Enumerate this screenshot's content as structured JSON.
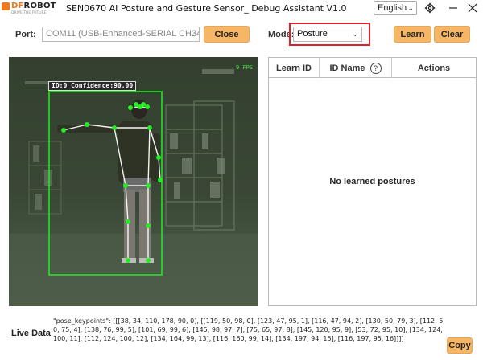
{
  "titlebar": {
    "logo_text_left": "DF",
    "logo_text_right": "ROBOT",
    "logo_tagline": "DRIVE THE FUTURE",
    "app_title": "SEN0670 AI Posture and Gesture Sensor_ Debug Assistant V1.0",
    "language": "English",
    "icons": [
      "settings-icon",
      "minimize-icon",
      "close-icon"
    ]
  },
  "controls": {
    "port_label": "Port:",
    "port_value": "COM11 (USB-Enhanced-SERIAL CH343)",
    "close_label": "Close",
    "mode_label": "Mode:",
    "mode_value": "Posture",
    "learn_label": "Learn",
    "clear_label": "Clear"
  },
  "camera": {
    "fps": "9 FPS",
    "detection_label": "ID:0 Confidence:90.00"
  },
  "table": {
    "columns": [
      "Learn ID",
      "ID Name",
      "Actions"
    ],
    "help_icon_glyph": "?",
    "empty_message": "No learned postures"
  },
  "live_data": {
    "label": "Live Data",
    "text": "\"pose_keypoints\": [[[38, 34, 110, 178, 90, 0], [[119, 50, 98, 0], [123, 47, 95, 1], [116, 47, 94, 2], [130, 50, 79, 3], [112, 50, 75, 4], [138, 76, 99, 5], [101, 69, 99, 6], [145, 98, 97, 7], [75, 65, 97, 8], [145, 120, 95, 9], [53, 72, 95, 10], [134, 124, 100, 11], [112, 124, 100, 12], [134, 164, 99, 13], [116, 160, 99, 14], [134, 197, 94, 15], [116, 197, 95, 16]]]]",
    "copy_label": "Copy"
  },
  "colors": {
    "accent_button": "#f6b665",
    "highlight_red": "#e0202a",
    "brand_orange": "#f07a1a",
    "overlay_green": "#22ee22"
  }
}
